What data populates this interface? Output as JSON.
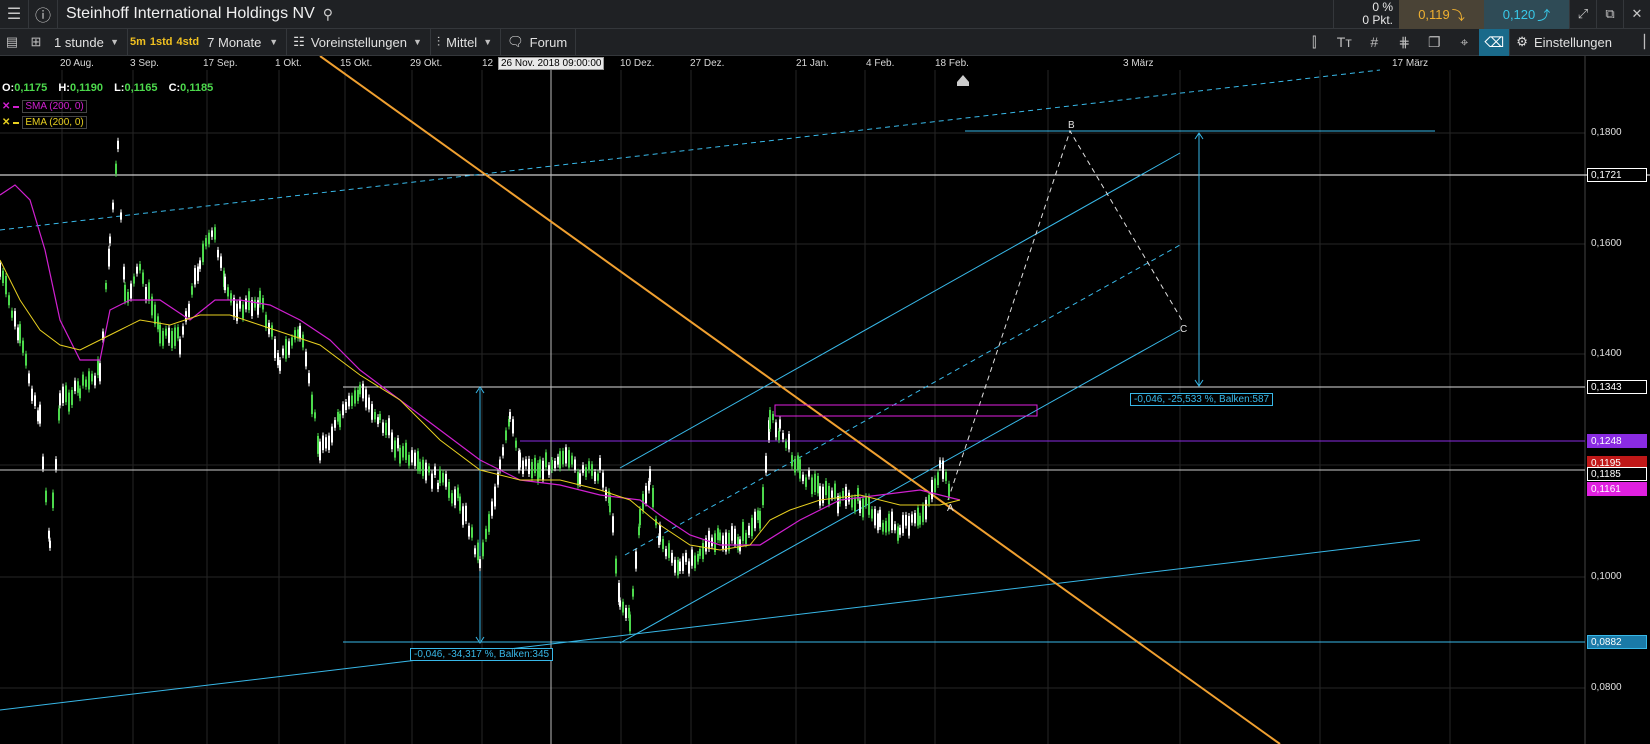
{
  "header": {
    "title": "Steinhoff International Holdings NV",
    "change_pct": "0 %",
    "change_pts": "0 Pkt.",
    "sell_price": "0,119",
    "buy_price": "0,120"
  },
  "toolbar": {
    "interval": "1 stunde",
    "quick": [
      "5m",
      "1std",
      "4std"
    ],
    "range": "7 Monate",
    "presets": "Voreinstellungen",
    "chart_type": "Mittel",
    "forum": "Forum",
    "settings": "Einstellungen"
  },
  "ohlc": {
    "o_label": "O:",
    "o": "0,1175",
    "h_label": "H:",
    "h": "0,1190",
    "l_label": "L:",
    "l": "0,1165",
    "c_label": "C:",
    "c": "0,1185"
  },
  "indicators": [
    {
      "name": "SMA (200, 0)",
      "color": "#d020d0"
    },
    {
      "name": "EMA (200, 0)",
      "color": "#e8d020"
    }
  ],
  "crosshair_date": "26 Nov. 2018 09:00:00",
  "x_axis_labels": [
    "20 Aug.",
    "3 Sep.",
    "17 Sep.",
    "1 Okt.",
    "15 Okt.",
    "29 Okt.",
    "12",
    "10 Dez.",
    "27 Dez.",
    "21 Jan.",
    "4 Feb.",
    "18 Feb.",
    "3 März",
    "17 März"
  ],
  "y_axis_labels": [
    "0,1800",
    "0,1600",
    "0,1400",
    "0,1000",
    "0,0800"
  ],
  "y_axis_markers": [
    {
      "label": "0,1721",
      "color": "#000000",
      "text": "#ffffff",
      "border": "#ffffff"
    },
    {
      "label": "0,1343",
      "color": "#000000",
      "text": "#ffffff",
      "border": "#ffffff"
    },
    {
      "label": "0,1248",
      "color": "#8a2be2",
      "text": "#ffffff",
      "border": "#8a2be2"
    },
    {
      "label": "0,1195",
      "color": "#c01818",
      "text": "#ffffff",
      "border": "#c01818"
    },
    {
      "label": "0,1185",
      "color": "#000000",
      "text": "#ffffff",
      "border": "#ffffff"
    },
    {
      "label": "0,1161",
      "color": "#e020e0",
      "text": "#ffffff",
      "border": "#e020e0"
    },
    {
      "label": "0,0882",
      "color": "#1a7aa8",
      "text": "#ffffff",
      "border": "#38b8e8"
    }
  ],
  "annotations": {
    "measure_left": "-0,046, -34,317 %, Balken:345",
    "measure_right": "-0,046, -25,533 %, Balken:587",
    "point_a": "A",
    "point_b": "B",
    "point_c": "C"
  },
  "colors": {
    "trendline": "#f0a030",
    "channel": "#38b8e8",
    "sma": "#d020d0",
    "ema": "#e8d020",
    "candle_up": "#4cd94c",
    "candle_down": "#ffffff"
  }
}
